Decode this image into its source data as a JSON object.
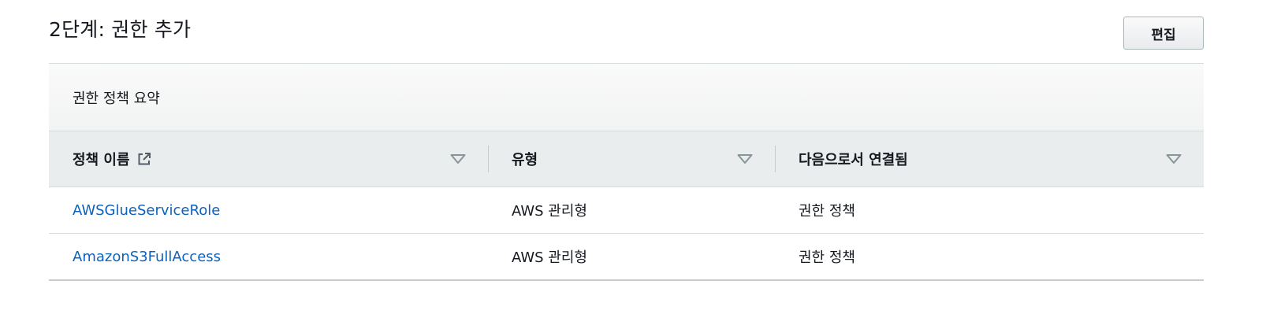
{
  "header": {
    "title": "2단계: 권한 추가",
    "edit_label": "편집"
  },
  "summary": {
    "label": "권한 정책 요약"
  },
  "table": {
    "columns": [
      {
        "label": "정책 이름",
        "icon": "external-link-icon"
      },
      {
        "label": "유형"
      },
      {
        "label": "다음으로서 연결됨"
      }
    ],
    "rows": [
      {
        "name": "AWSGlueServiceRole",
        "type": "AWS 관리형",
        "attached_as": "권한 정책"
      },
      {
        "name": "AmazonS3FullAccess",
        "type": "AWS 관리형",
        "attached_as": "권한 정책"
      }
    ]
  },
  "colors": {
    "link": "#0d62bd",
    "header_bg": "#eaeded",
    "border": "#d5dbdb"
  }
}
